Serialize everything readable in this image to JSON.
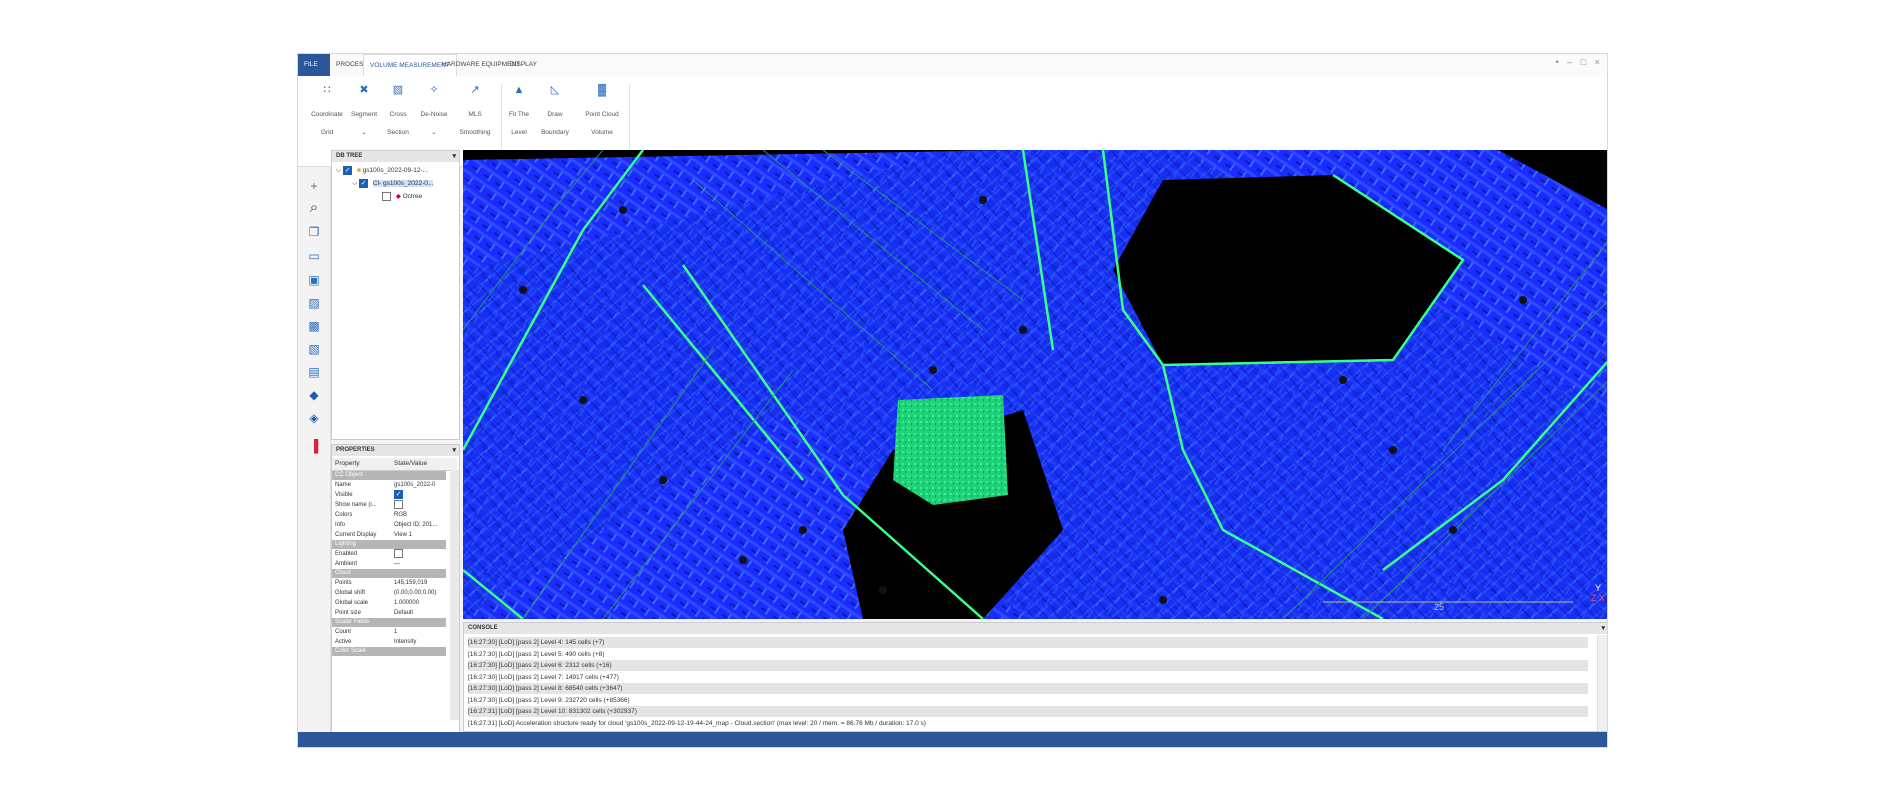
{
  "ribbon": {
    "tabs": [
      "FILE",
      "PROCESS",
      "VOLUME MEASUREMENT",
      "HARDWARE EQUIPMENT",
      "DISPLAY"
    ],
    "buttons": [
      {
        "icon": "coordinate-grid-icon",
        "line1": "Coordinate",
        "line2": "Grid"
      },
      {
        "icon": "segment-icon",
        "line1": "Segment",
        "line2": "⌄"
      },
      {
        "icon": "cross-section-icon",
        "line1": "Cross",
        "line2": "Section"
      },
      {
        "icon": "denoise-icon",
        "line1": "De-Noise",
        "line2": "⌄"
      },
      {
        "icon": "mls-smoothing-icon",
        "line1": "MLS",
        "line2": "Smoothing"
      },
      {
        "icon": "fit-level-icon",
        "line1": "Fit The",
        "line2": "Level"
      },
      {
        "icon": "draw-boundary-icon",
        "line1": "Draw",
        "line2": "Boundary"
      },
      {
        "icon": "point-cloud-volume-icon",
        "line1": "Point Cloud",
        "line2": "Volume"
      }
    ],
    "window_controls": "• – □ ×"
  },
  "left_toolbar": [
    "plus-icon",
    "zoom-icon",
    "layers-icon",
    "view-icon",
    "cube-icon",
    "cube-front-icon",
    "cube-side-icon",
    "cube-back-icon",
    "cube-top-icon",
    "shield-icon",
    "shield-alt-icon",
    "color-scale-icon"
  ],
  "db_tree": {
    "title": "DB TREE",
    "items": [
      {
        "label": "gs100s_2022-09-12-...",
        "checked": true
      },
      {
        "label": "Cl- gs100s_2022-0...",
        "checked": true
      },
      {
        "label": "Octree",
        "checked": false
      }
    ]
  },
  "properties": {
    "title": "PROPERTIES",
    "header": {
      "key": "Property",
      "value": "State/Value"
    },
    "rows": [
      {
        "section": "CC Object"
      },
      {
        "k": "Name",
        "v": "gs100s_2022-0"
      },
      {
        "k": "Visible",
        "cb": true
      },
      {
        "k": "Show name (i...",
        "cb": false
      },
      {
        "k": "Colors",
        "v": "RGB"
      },
      {
        "k": "Info",
        "v": "Object ID: 201..."
      },
      {
        "k": "Current Display",
        "v": "View 1"
      },
      {
        "section": "Lighting"
      },
      {
        "k": "Enabled",
        "cb": false
      },
      {
        "k": "Ambient",
        "v": "—"
      },
      {
        "section": "Cloud"
      },
      {
        "k": "Points",
        "v": "145,159,019"
      },
      {
        "k": "Global shift",
        "v": "(0.00;0.00;0.00)"
      },
      {
        "k": "Global scale",
        "v": "1.000000"
      },
      {
        "k": "Point size",
        "v": "Default"
      },
      {
        "section": "Scalar Fields"
      },
      {
        "k": "Count",
        "v": "1"
      },
      {
        "k": "Active",
        "v": "Intensity"
      },
      {
        "section": "Color Scale"
      }
    ]
  },
  "console": {
    "title": "CONSOLE",
    "lines": [
      "[16:27:30] [LoD] [pass 2] Level 4: 145 cells (+7)",
      "[16:27:30] [LoD] [pass 2] Level 5: 490 cells (+8)",
      "[16:27:30] [LoD] [pass 2] Level 6: 2312 cells (+16)",
      "[16:27:30] [LoD] [pass 2] Level 7: 14917 cells (+477)",
      "[16:27:30] [LoD] [pass 2] Level 8: 68540 cells (+3647)",
      "[16:27:30] [LoD] [pass 2] Level 9: 232720 cells (+85366)",
      "[16:27:31] [LoD] [pass 2] Level 10: 831302 cells (+302937)",
      "[16:27:31] [LoD] Acceleration structure ready for cloud 'gs100s_2022-09-12-19-44-24_map - Cloud.section' (max level: 20 / mem. = 86.76 Mb / duration: 17.0 s)"
    ]
  },
  "viewport": {
    "scale_label": "25",
    "axis_labels": [
      "Y",
      "Z X"
    ],
    "colors": {
      "background": "#000000",
      "cloud": "#1a2cff",
      "highlight": "#22e07a",
      "edges": "#39ff88"
    }
  },
  "colors": {
    "accent": "#2b579a"
  }
}
